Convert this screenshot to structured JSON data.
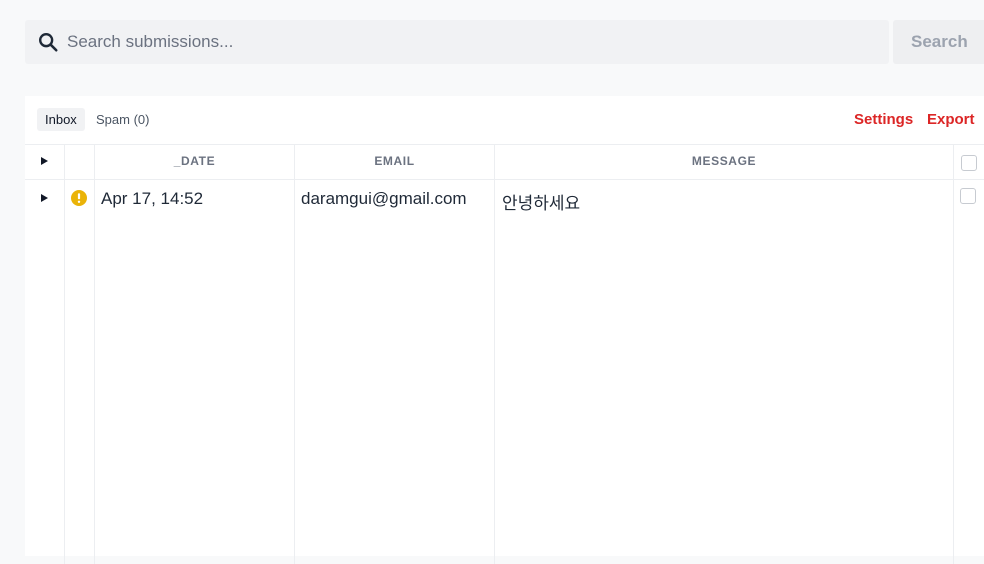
{
  "search": {
    "placeholder": "Search submissions...",
    "value": "",
    "button_label": "Search"
  },
  "tabs": [
    {
      "label": "Inbox",
      "active": true
    },
    {
      "label": "Spam (0)",
      "active": false
    }
  ],
  "actions": {
    "settings_label": "Settings",
    "export_label": "Export"
  },
  "table": {
    "columns": [
      "_DATE",
      "EMAIL",
      "MESSAGE"
    ],
    "rows": [
      {
        "status_icon": "alert-icon",
        "date": "Apr 17, 14:52",
        "email": "daramgui@gmail.com",
        "message": "안녕하세요",
        "selected": false
      }
    ],
    "select_all": false
  },
  "colors": {
    "accent": "#dc2626",
    "warning": "#eab308",
    "background": "#f8f9fa"
  }
}
